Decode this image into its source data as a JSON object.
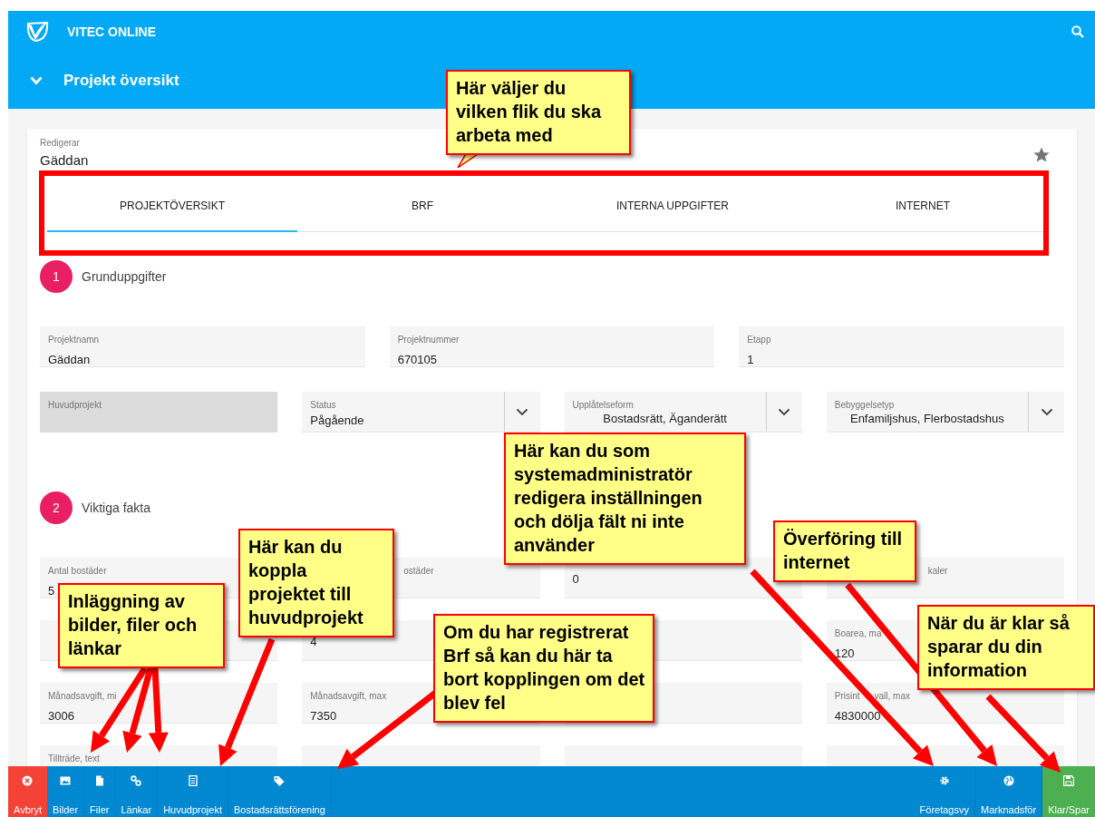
{
  "header": {
    "app_title": "VITEC ONLINE",
    "page_title": "Projekt översikt"
  },
  "card": {
    "editing_label": "Redigerar",
    "editing_value": "Gäddan"
  },
  "tabs": [
    {
      "label": "PROJEKTÖVERSIKT",
      "selected": true
    },
    {
      "label": "BRF",
      "selected": false
    },
    {
      "label": "INTERNA UPPGIFTER",
      "selected": false
    },
    {
      "label": "INTERNET",
      "selected": false
    }
  ],
  "sections": [
    {
      "number": "1",
      "title": "Grunduppgifter",
      "rows": [
        [
          {
            "kind": "text",
            "label": "Projektnamn",
            "value": "Gäddan",
            "disabled": false
          },
          {
            "kind": "text",
            "label": "Projektnummer",
            "value": "670105",
            "disabled": false
          },
          {
            "kind": "text",
            "label": "Etapp",
            "value": "1",
            "disabled": false
          }
        ],
        [
          {
            "kind": "text",
            "label": "Huvudprojekt",
            "disabled": true
          },
          {
            "kind": "select",
            "label": "Status",
            "value": "Pågående",
            "disabled": false
          },
          {
            "kind": "multiselect",
            "label": "Upplåtelseform",
            "value": "Bostadsrätt,  Äganderätt",
            "disabled": false
          },
          {
            "kind": "multiselect",
            "label": "Bebyggelsetyp",
            "value": "Enfamiljshus,  Flerbostadshus",
            "disabled": false
          }
        ]
      ]
    },
    {
      "number": "2",
      "title": "Viktiga fakta",
      "rows": [
        [
          {
            "kind": "text",
            "label": "Antal bostäder",
            "value": "5",
            "disabled": false
          },
          {
            "kind": "covered",
            "label": "ostäder",
            "disabled": false
          },
          {
            "kind": "text",
            "value": "0",
            "disabled": false
          },
          {
            "kind": "covered",
            "label": "kaler",
            "disabled": false
          }
        ],
        [
          {
            "kind": "text",
            "disabled": false
          },
          {
            "kind": "text",
            "value": "4",
            "disabled": false
          },
          {
            "kind": "text",
            "disabled": false
          },
          {
            "kind": "text",
            "label": "Boarea, ma",
            "value": "120",
            "disabled": false
          }
        ],
        [
          {
            "kind": "text",
            "label": "Månadsavgift, mi",
            "value": "3006",
            "disabled": false
          },
          {
            "kind": "text",
            "label": "Månadsavgift, max",
            "value": "7350",
            "disabled": false
          },
          {
            "kind": "text",
            "disabled": false
          },
          {
            "kind": "text",
            "label_parts": [
              "Prisint",
              "vall, max"
            ],
            "value": "4830000",
            "disabled": false
          }
        ],
        [
          {
            "kind": "text",
            "label": "Tillträde, text",
            "disabled": false
          },
          {
            "kind": "text",
            "disabled": false
          },
          {
            "kind": "text",
            "disabled": false
          },
          {
            "kind": "text",
            "disabled": false
          }
        ]
      ]
    }
  ],
  "toolbar": {
    "left": [
      {
        "kind": "cancel",
        "label": "Avbryt"
      },
      {
        "kind": "normal",
        "label": "Bilder"
      },
      {
        "kind": "normal",
        "label": "Filer"
      },
      {
        "kind": "normal",
        "label": "Länkar"
      },
      {
        "kind": "normal",
        "label": "Huvudprojekt"
      },
      {
        "kind": "normal",
        "label": "Bostadsrättsförening"
      }
    ],
    "right": [
      {
        "kind": "normal",
        "label": "Företagsvy"
      },
      {
        "kind": "normal",
        "label": "Marknadsför"
      },
      {
        "kind": "save",
        "label": "Klar/Spar"
      }
    ]
  },
  "callouts": [
    "Här väljer du vilken flik du ska arbeta med",
    "Här kan du som systemadministratör redigera inställningen och dölja fält ni inte använder",
    "Överföring till internet",
    "Inläggning av bilder, filer och länkar",
    "Här kan du koppla projektet till huvudprojekt",
    "Om du har registrerat Brf så kan du här ta bort kopplingen om det blev fel",
    "När du är klar så sparar du din information"
  ]
}
